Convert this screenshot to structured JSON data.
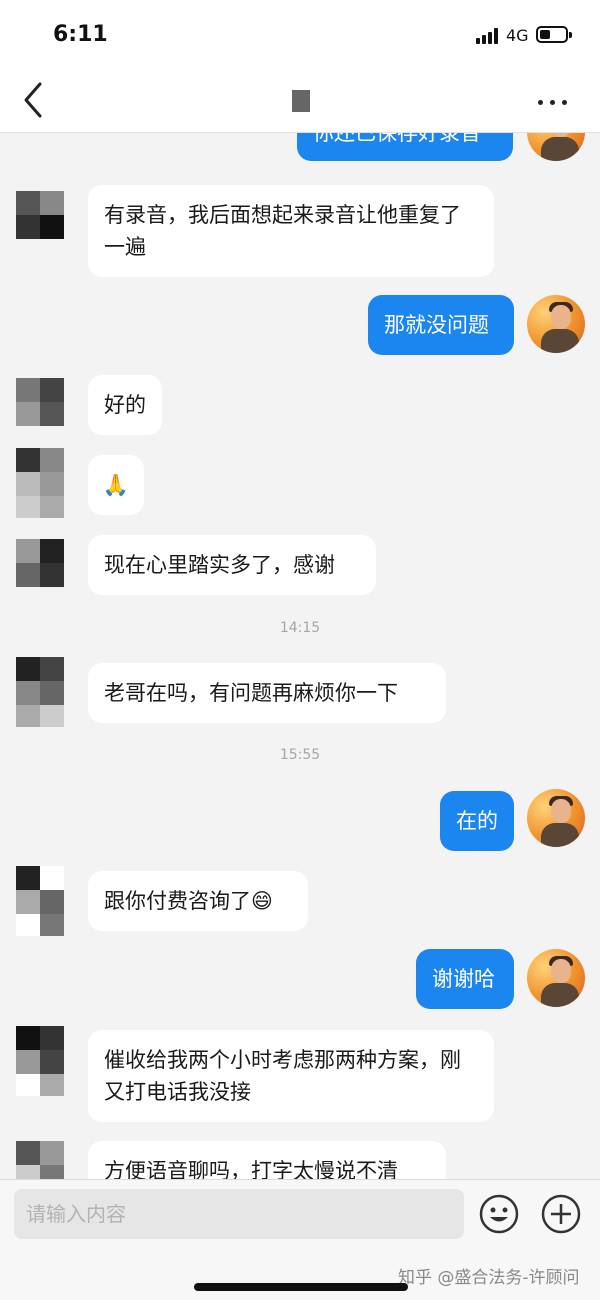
{
  "status": {
    "time": "6:11",
    "network": "4G"
  },
  "nav": {
    "title": ""
  },
  "messages": {
    "m0": "你还已保存好录音",
    "m1": "有录音，我后面想起来录音让他重复了一遍",
    "m2": "那就没问题",
    "m3": "好的",
    "m4": "🙏",
    "m5": "现在心里踏实多了，感谢",
    "t1": "14:15",
    "m6": "老哥在吗，有问题再麻烦你一下",
    "t2": "15:55",
    "m7": "在的",
    "m8": "跟你付费咨询了😄",
    "m9": "谢谢哈",
    "m10": "催收给我两个小时考虑那两种方案，刚又打电话我没接",
    "m11": "方便语音聊吗，打字太慢说不清"
  },
  "input": {
    "placeholder": "请输入内容"
  },
  "watermark": "知乎 @盛合法务-许顾问",
  "colors": {
    "outgoing": "#1c86f0",
    "incoming": "#ffffff",
    "background": "#f3f3f3"
  },
  "icons": [
    "back-arrow-icon",
    "more-icon",
    "emoji-icon",
    "plus-icon"
  ]
}
